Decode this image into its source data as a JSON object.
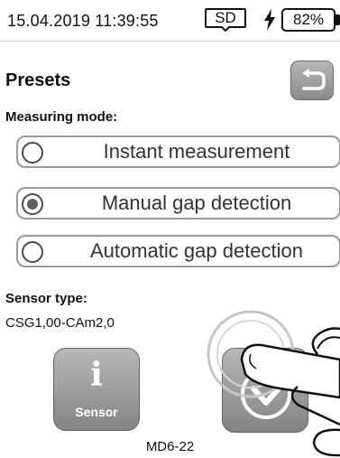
{
  "status_bar": {
    "datetime": "15.04.2019 11:39:55",
    "storage_label": "SD",
    "battery_percent": "82%",
    "icons": {
      "storage": "sd-card-icon",
      "charging": "lightning-bolt-icon",
      "battery": "battery-icon"
    }
  },
  "header": {
    "title": "Presets",
    "back_icon": "return-arrow-icon"
  },
  "measuring_mode": {
    "label": "Measuring mode:",
    "options": [
      {
        "label": "Instant measurement",
        "selected": false
      },
      {
        "label": "Manual gap detection",
        "selected": true
      },
      {
        "label": "Automatic gap detection",
        "selected": false
      }
    ]
  },
  "sensor": {
    "label": "Sensor type:",
    "value": "CSG1,00-CAm2,0"
  },
  "buttons": {
    "info_glyph": "i",
    "info_label": "Sensor",
    "down_icon": "chevron-down-icon"
  },
  "footer": {
    "model": "MD6-22"
  },
  "colors": {
    "button_gray": "#9e9e9e",
    "button_border": "#666666",
    "option_border": "#9a9a9a",
    "text": "#111111"
  }
}
